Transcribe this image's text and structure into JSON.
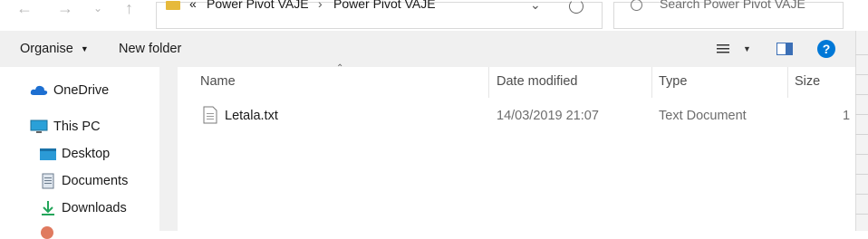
{
  "address": {
    "prefix": "«",
    "crumbs": [
      "Power Pivot VAJE",
      "Power Pivot VAJE"
    ],
    "separator": "›"
  },
  "search": {
    "placeholder": "Search Power Pivot VAJE"
  },
  "toolbar": {
    "organise_label": "Organise",
    "new_folder_label": "New folder"
  },
  "navigation": {
    "items": [
      {
        "label": "OneDrive",
        "icon": "onedrive-cloud-icon"
      },
      {
        "label": "This PC",
        "icon": "monitor-icon"
      },
      {
        "label": "Desktop",
        "icon": "desktop-folder-icon"
      },
      {
        "label": "Documents",
        "icon": "documents-icon"
      },
      {
        "label": "Downloads",
        "icon": "download-arrow-icon"
      }
    ]
  },
  "columns": {
    "name": "Name",
    "date_modified": "Date modified",
    "type": "Type",
    "size": "Size"
  },
  "files": [
    {
      "name": "Letala.txt",
      "date_modified": "14/03/2019 21:07",
      "type": "Text Document",
      "size": "1"
    }
  ],
  "colors": {
    "accent": "#0078d7",
    "toolbar_bg": "#f0f0f0",
    "onedrive_blue": "#1d6fd1",
    "download_green": "#23a55a"
  }
}
